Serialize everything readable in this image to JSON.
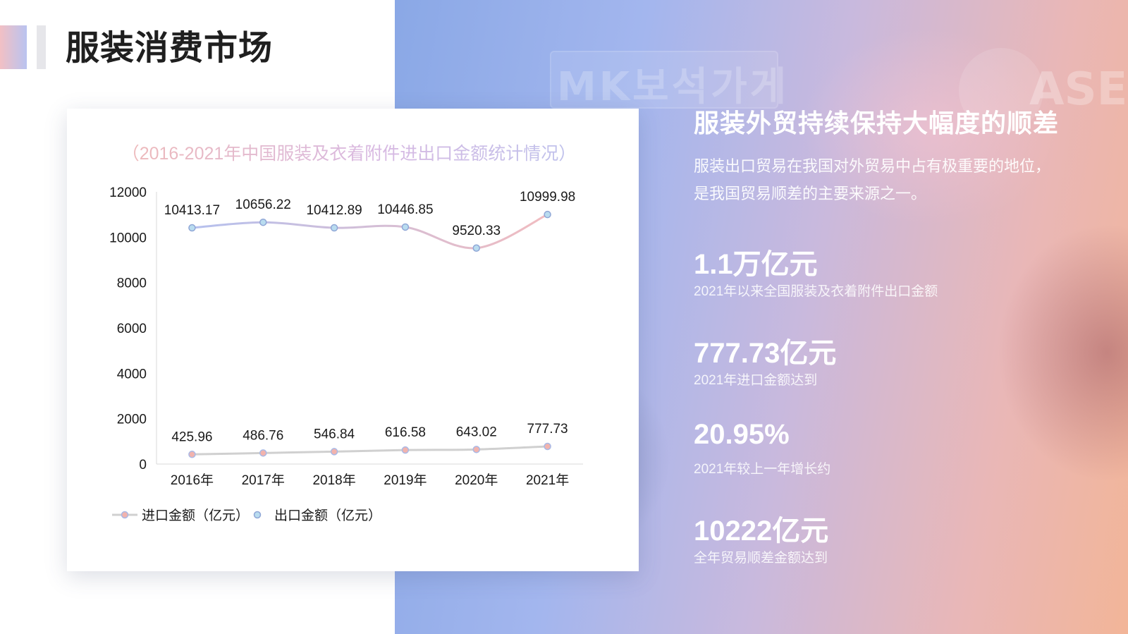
{
  "page_title": "服装消费市场",
  "chart_data": {
    "type": "line",
    "title": "（2016-2021年中国服装及衣着附件进出口金额统计情况）",
    "categories": [
      "2016年",
      "2017年",
      "2018年",
      "2019年",
      "2020年",
      "2021年"
    ],
    "ylim": [
      0,
      12000
    ],
    "yticks": [
      0,
      2000,
      4000,
      6000,
      8000,
      10000,
      12000
    ],
    "grid": false,
    "legend_position": "bottom-left",
    "series": [
      {
        "name": "进口金额（亿元）",
        "values": [
          425.96,
          486.76,
          546.84,
          616.58,
          643.02,
          777.73
        ],
        "labels": [
          "425.96",
          "486.76",
          "546.84",
          "616.58",
          "643.02",
          "777.73"
        ],
        "line_color": "#d0d0d0",
        "marker_fill": "#f2b3ad",
        "marker_stroke": "#a9b9e6"
      },
      {
        "name": "出口金额（亿元）",
        "values": [
          10413.17,
          10656.22,
          10412.89,
          10446.85,
          9520.33,
          10999.98
        ],
        "labels": [
          "10413.17",
          "10656.22",
          "10412.89",
          "10446.85",
          "9520.33",
          "10999.98"
        ],
        "line_color_start": "#b5c0ee",
        "line_color_end": "#f1bcc0",
        "marker_fill": "#b9dcef",
        "marker_stroke": "#8fa6d6"
      }
    ]
  },
  "side_panel": {
    "heading": "服装外贸持续保持大幅度的顺差",
    "desc_line1": "服装出口贸易在我国对外贸易中占有极重要的地位，",
    "desc_line2": "是我国贸易顺差的主要来源之一。",
    "stats": [
      {
        "value": "1.1万亿元",
        "label": "2021年以来全国服装及衣着附件出口金额"
      },
      {
        "value": "777.73亿元",
        "label": "2021年进口金额达到"
      },
      {
        "value": "20.95%",
        "label": "2021年较上一年增长约"
      },
      {
        "value": "10222亿元",
        "label": "全年贸易顺差金额达到"
      }
    ]
  },
  "background": {
    "sign_text": "MK보석가게",
    "sign_text_right": "ASE"
  },
  "colors": {
    "title_text": "#1f1f1f",
    "accent_pink": "#f2c0c4",
    "accent_blue": "#b9c3f0"
  }
}
